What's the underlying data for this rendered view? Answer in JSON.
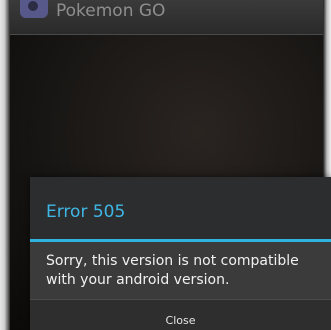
{
  "app": {
    "title": "Pokemon GO",
    "icon": "pokemon-go-app-icon"
  },
  "dialog": {
    "title": "Error 505",
    "message": "Sorry, this version is not compatible with your android version.",
    "close_label": "Close"
  },
  "colors": {
    "accent": "#2fb3e0",
    "dialog_title": "#3fb7e6",
    "dialog_background": "#3a3a3a",
    "message_text": "#f1f1f1"
  }
}
